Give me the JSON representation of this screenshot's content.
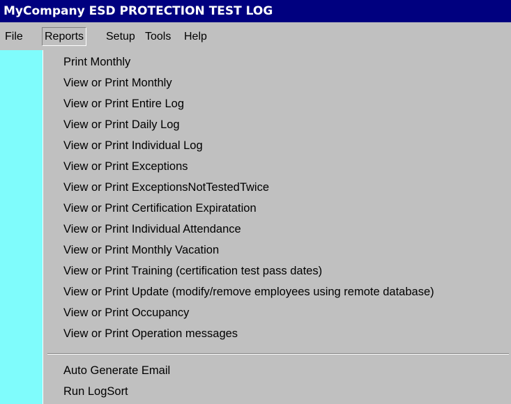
{
  "window": {
    "title": "MyCompany ESD PROTECTION TEST LOG"
  },
  "menubar": {
    "items": [
      {
        "label": "File"
      },
      {
        "label": "Reports",
        "active": true
      },
      {
        "label": "Setup"
      },
      {
        "label": "Tools"
      },
      {
        "label": "Help"
      }
    ]
  },
  "reports_menu": {
    "items": [
      {
        "label": "Print Monthly"
      },
      {
        "label": "View or Print Monthly"
      },
      {
        "label": "View or Print Entire Log"
      },
      {
        "label": "View or Print Daily Log"
      },
      {
        "label": "View or Print Individual Log"
      },
      {
        "label": "View or Print Exceptions"
      },
      {
        "label": "View or Print ExceptionsNotTestedTwice"
      },
      {
        "label": "View or Print Certification Expiratation"
      },
      {
        "label": "View or Print Individual Attendance"
      },
      {
        "label": "View or Print Monthly Vacation"
      },
      {
        "label": "View or Print Training (certification test pass dates)"
      },
      {
        "label": "View or Print Update (modify/remove employees using remote database)"
      },
      {
        "label": "View or Print Occupancy"
      },
      {
        "label": "View or Print Operation messages"
      }
    ],
    "extra_items": [
      {
        "label": "Auto Generate Email"
      },
      {
        "label": "Run LogSort"
      }
    ]
  },
  "colors": {
    "titlebar": "#00007f",
    "menu_bg": "#c0c0c0",
    "left_panel": "#7ffcfc"
  }
}
